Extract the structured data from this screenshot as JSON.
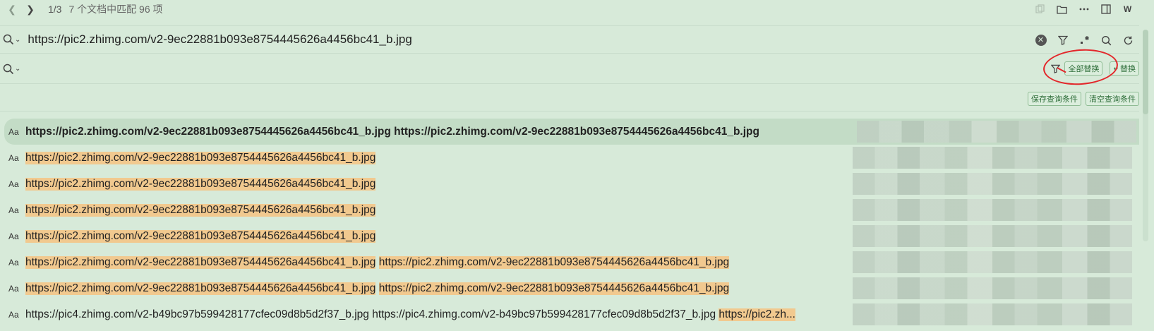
{
  "nav": {
    "back_icon": "chevron-left-icon",
    "forward_icon": "chevron-right-icon",
    "counter": "1/3",
    "summary": "7 个文档中匹配 96 项"
  },
  "window_icons": [
    "copy-icon",
    "folder-icon",
    "more-icon",
    "split-view-icon",
    "w-icon"
  ],
  "window_icon_glyphs": {
    "w_label": "W"
  },
  "search": {
    "query": "https://pic2.zhimg.com/v2-9ec22881b093e8754445626a4456bc41_b.jpg",
    "tools": [
      "clear-icon",
      "filter-icon",
      "regex-icon",
      "search-scope-icon",
      "refresh-icon"
    ]
  },
  "replace": {
    "value": "",
    "replace_all_label": "全部替换",
    "replace_label": "替换"
  },
  "query": {
    "save_label": "保存查询条件",
    "clear_label": "清空查询条件"
  },
  "annotation_color": "#e3262a",
  "highlight_color": "#f1c98f",
  "results": [
    {
      "icon": "Aa",
      "bold": true,
      "selected": true,
      "segments": [
        {
          "text": "https://pic2.zhimg.com/v2-9ec22881b093e8754445626a4456bc41_b.jpg",
          "hl": false
        },
        {
          "text": " ",
          "hl": false
        },
        {
          "text": "https://pic2.zhimg.com/v2-9ec22881b093e8754445626a4456bc41_b.jpg",
          "hl": false
        }
      ]
    },
    {
      "icon": "Aa",
      "bold": false,
      "selected": false,
      "segments": [
        {
          "text": "https://pic2.zhimg.com/v2-9ec22881b093e8754445626a4456bc41_b.jpg",
          "hl": true
        }
      ]
    },
    {
      "icon": "Aa",
      "bold": false,
      "selected": false,
      "segments": [
        {
          "text": "https://pic2.zhimg.com/v2-9ec22881b093e8754445626a4456bc41_b.jpg",
          "hl": true
        }
      ]
    },
    {
      "icon": "Aa",
      "bold": false,
      "selected": false,
      "segments": [
        {
          "text": "https://pic2.zhimg.com/v2-9ec22881b093e8754445626a4456bc41_b.jpg",
          "hl": true
        }
      ]
    },
    {
      "icon": "Aa",
      "bold": false,
      "selected": false,
      "segments": [
        {
          "text": "https://pic2.zhimg.com/v2-9ec22881b093e8754445626a4456bc41_b.jpg",
          "hl": true
        }
      ]
    },
    {
      "icon": "Aa",
      "bold": false,
      "selected": false,
      "segments": [
        {
          "text": "https://pic2.zhimg.com/v2-9ec22881b093e8754445626a4456bc41_b.jpg",
          "hl": true
        },
        {
          "text": " ",
          "hl": false
        },
        {
          "text": "https://pic2.zhimg.com/v2-9ec22881b093e8754445626a4456bc41_b.jpg",
          "hl": true
        }
      ]
    },
    {
      "icon": "Aa",
      "bold": false,
      "selected": false,
      "segments": [
        {
          "text": "https://pic2.zhimg.com/v2-9ec22881b093e8754445626a4456bc41_b.jpg",
          "hl": true
        },
        {
          "text": " ",
          "hl": false
        },
        {
          "text": "https://pic2.zhimg.com/v2-9ec22881b093e8754445626a4456bc41_b.jpg",
          "hl": true
        }
      ]
    },
    {
      "icon": "Aa",
      "bold": false,
      "selected": false,
      "segments": [
        {
          "text": "https://pic4.zhimg.com/v2-b49bc97b599428177cfec09d8b5d2f37_b.jpg",
          "hl": false
        },
        {
          "text": " ",
          "hl": false
        },
        {
          "text": "https://pic4.zhimg.com/v2-b49bc97b599428177cfec09d8b5d2f37_b.jpg",
          "hl": false
        },
        {
          "text": " ",
          "hl": false
        },
        {
          "text": "https://pic2.zh...",
          "hl": true
        }
      ]
    }
  ]
}
